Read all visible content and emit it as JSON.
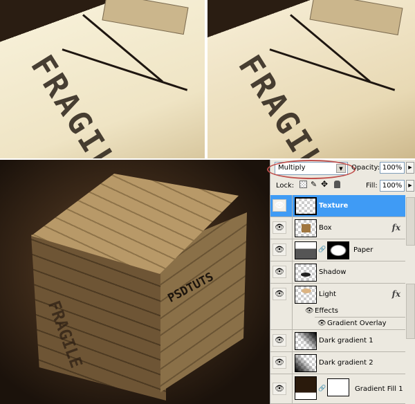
{
  "photos": {
    "crate_text_top": "FRAGILE",
    "crate_text_side": "PSDTUTS",
    "crate_text_left": "FRAGILE"
  },
  "panel": {
    "blend_mode": "Multiply",
    "opacity_label": "Opacity:",
    "opacity_value": "100%",
    "lock_label": "Lock:",
    "fill_label": "Fill:",
    "fill_value": "100%",
    "layers": [
      {
        "name": "Texture",
        "selected": true
      },
      {
        "name": "Box",
        "fx": "fx"
      },
      {
        "name": "Paper",
        "mask": true
      },
      {
        "name": "Shadow"
      },
      {
        "name": "Light",
        "fx": "fx",
        "effects_label": "Effects",
        "effect": "Gradient Overlay"
      },
      {
        "name": "Dark gradient 1"
      },
      {
        "name": "Dark gradient 2"
      },
      {
        "name": "Gradient Fill 1",
        "mask": true
      }
    ]
  },
  "colors": {
    "selection": "#3f9bf5",
    "highlight_ring": "#c0504d",
    "panel_bg": "#ece9e0"
  }
}
